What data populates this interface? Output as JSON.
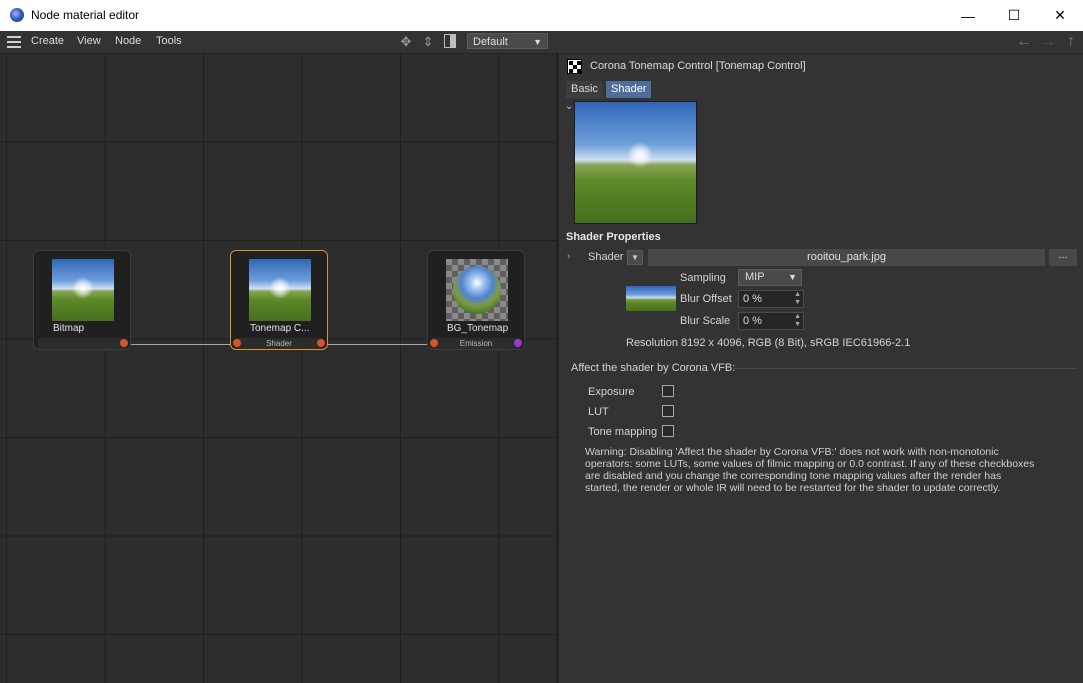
{
  "window": {
    "title": "Node material editor",
    "minimize": "—",
    "maximize": "☐",
    "close": "✕"
  },
  "menu": {
    "items": [
      "Create",
      "View",
      "Node",
      "Tools"
    ],
    "layout": "Default"
  },
  "nodes": [
    {
      "label": "Bitmap",
      "port_label": "",
      "selected": false,
      "out_color": "#d2552b"
    },
    {
      "label": "Tonemap C...",
      "port_label": "Shader",
      "selected": true,
      "in_color": "#d2552b",
      "out_color": "#d2552b"
    },
    {
      "label": "BG_Tonemap",
      "port_label": "Emission",
      "selected": false,
      "in_color": "#d2552b",
      "out_color": "#9b3bc4"
    }
  ],
  "panel": {
    "title": "Corona Tonemap Control [Tonemap Control]",
    "tabs": [
      {
        "label": "Basic",
        "active": false
      },
      {
        "label": "Shader",
        "active": true
      }
    ],
    "section_title": "Shader Properties",
    "shader_label": "Shader",
    "file_name": "rooitou_park.jpg",
    "browse_label": "...",
    "sampling_label": "Sampling",
    "sampling_value": "MIP",
    "blur_offset_label": "Blur Offset",
    "blur_offset_value": "0 %",
    "blur_scale_label": "Blur Scale",
    "blur_scale_value": "0 %",
    "resolution": "Resolution 8192 x 4096, RGB (8 Bit), sRGB IEC61966-2.1",
    "group_title": "Affect the shader by Corona VFB:",
    "checkboxes": [
      {
        "label": "Exposure",
        "checked": false
      },
      {
        "label": "LUT",
        "checked": false
      },
      {
        "label": "Tone mapping",
        "checked": false
      }
    ],
    "warning": "Warning: Disabling 'Affect the shader by Corona VFB:' does not work with non-monotonic operators: some LUTs, some values of filmic mapping or 0.0 contrast. If any of these checkboxes are disabled and you change the corresponding tone mapping values after the render has started, the render or whole IR will need to be restarted for the shader to update correctly."
  }
}
